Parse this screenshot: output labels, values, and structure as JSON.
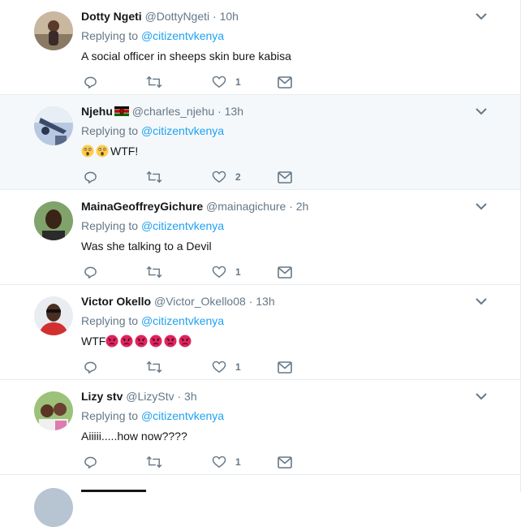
{
  "tweets": [
    {
      "name": "Dotty Ngeti",
      "handle": "@DottyNgeti",
      "separator": "·",
      "time": "10h",
      "replying_prefix": "Replying to",
      "replying_to": "@citizentvkenya",
      "text": "A social officer in sheeps skin bure kabisa",
      "likes": "1",
      "flag": false,
      "emoji": "",
      "emoji_count": 0
    },
    {
      "name": "Njehu",
      "handle": "@charles_njehu",
      "separator": "·",
      "time": "13h",
      "replying_prefix": "Replying to",
      "replying_to": "@citizentvkenya",
      "text": "WTF!",
      "likes": "2",
      "flag": true,
      "emoji": "astonished-face",
      "emoji_count": 2
    },
    {
      "name": "MainaGeoffreyGichure",
      "handle": "@mainagichure",
      "separator": "·",
      "time": "2h",
      "replying_prefix": "Replying to",
      "replying_to": "@citizentvkenya",
      "text": "Was she talking to a Devil",
      "likes": "1",
      "flag": false,
      "emoji": "",
      "emoji_count": 0
    },
    {
      "name": "Victor Okello",
      "handle": "@Victor_Okello08",
      "separator": "·",
      "time": "13h",
      "replying_prefix": "Replying to",
      "replying_to": "@citizentvkenya",
      "text": "WTF",
      "likes": "1",
      "flag": false,
      "emoji": "pouting-face",
      "emoji_count": 6
    },
    {
      "name": "Lizy stv",
      "handle": "@LizyStv",
      "separator": "·",
      "time": "3h",
      "replying_prefix": "Replying to",
      "replying_to": "@citizentvkenya",
      "text": "Aiiiii.....how now????",
      "likes": "1",
      "flag": false,
      "emoji": "",
      "emoji_count": 0
    }
  ],
  "icons": {
    "reply": "reply-icon",
    "retweet": "retweet-icon",
    "like": "heart-icon",
    "dm": "envelope-icon",
    "more": "chevron-down-icon"
  },
  "colors": {
    "link": "#1da1f2",
    "muted": "#657786",
    "highlight": "#f5f8fa",
    "pouting": "#e0245e",
    "astonished": "#ffcc4d"
  }
}
